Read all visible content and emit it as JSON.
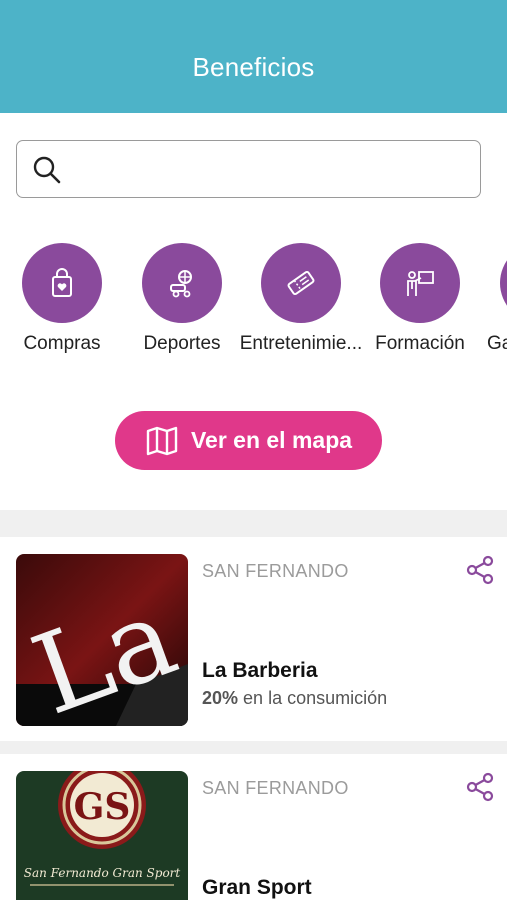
{
  "header": {
    "title": "Beneficios"
  },
  "search": {
    "placeholder": ""
  },
  "categories": [
    {
      "label": "Compras",
      "icon": "shopping-bag-icon"
    },
    {
      "label": "Deportes",
      "icon": "sports-icon"
    },
    {
      "label": "Entretenimie...",
      "icon": "ticket-icon"
    },
    {
      "label": "Formación",
      "icon": "teacher-icon"
    },
    {
      "label": "Ga",
      "icon": "category-icon"
    }
  ],
  "map_button": {
    "label": "Ver en el mapa",
    "icon": "map-icon"
  },
  "benefits": [
    {
      "location": "SAN FERNANDO",
      "name": "La Barberia",
      "discount": "20%",
      "offer_text": "en la consumición",
      "image_text": "La Ba"
    },
    {
      "location": "SAN FERNANDO",
      "name": "Gran Sport",
      "logo_text": "GS",
      "logo_caption": "San Fernando Gran Sport"
    }
  ],
  "colors": {
    "header": "#4db3c8",
    "category": "#8a4a9c",
    "map_button": "#e0388a",
    "share": "#8a4a9c"
  }
}
